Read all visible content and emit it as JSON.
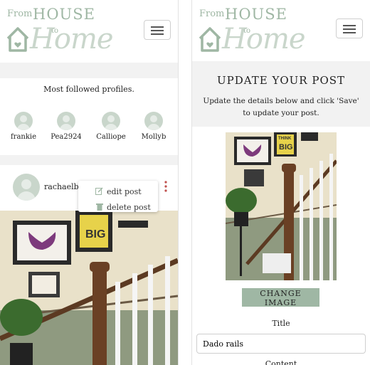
{
  "logo": {
    "from": "From",
    "house": "HOUSE",
    "to": "to",
    "home": "Home"
  },
  "left": {
    "most_followed_title": "Most followed profiles.",
    "profiles": [
      {
        "name": "frankie"
      },
      {
        "name": "Pea2924"
      },
      {
        "name": "Calliope"
      },
      {
        "name": "Mollyb"
      }
    ],
    "post": {
      "author": "rachaelb",
      "menu": {
        "edit": "edit post",
        "delete": "delete post"
      }
    }
  },
  "right": {
    "title": "UPDATE YOUR POST",
    "subtitle": "Update the details below and click 'Save' to update your post.",
    "change_image_label": "CHANGE IMAGE",
    "title_label": "Title",
    "title_value": "Dado rails",
    "content_label": "Content"
  },
  "photo_art": {
    "big_text": "BIG",
    "think_text": "THINK"
  },
  "colors": {
    "sage": "#9fb7a4",
    "sage_light": "#c9d6cb",
    "kebab": "#c0504d"
  },
  "icons": {
    "menu": "hamburger-icon",
    "edit": "edit-icon",
    "delete": "trash-icon",
    "more": "kebab-icon"
  }
}
